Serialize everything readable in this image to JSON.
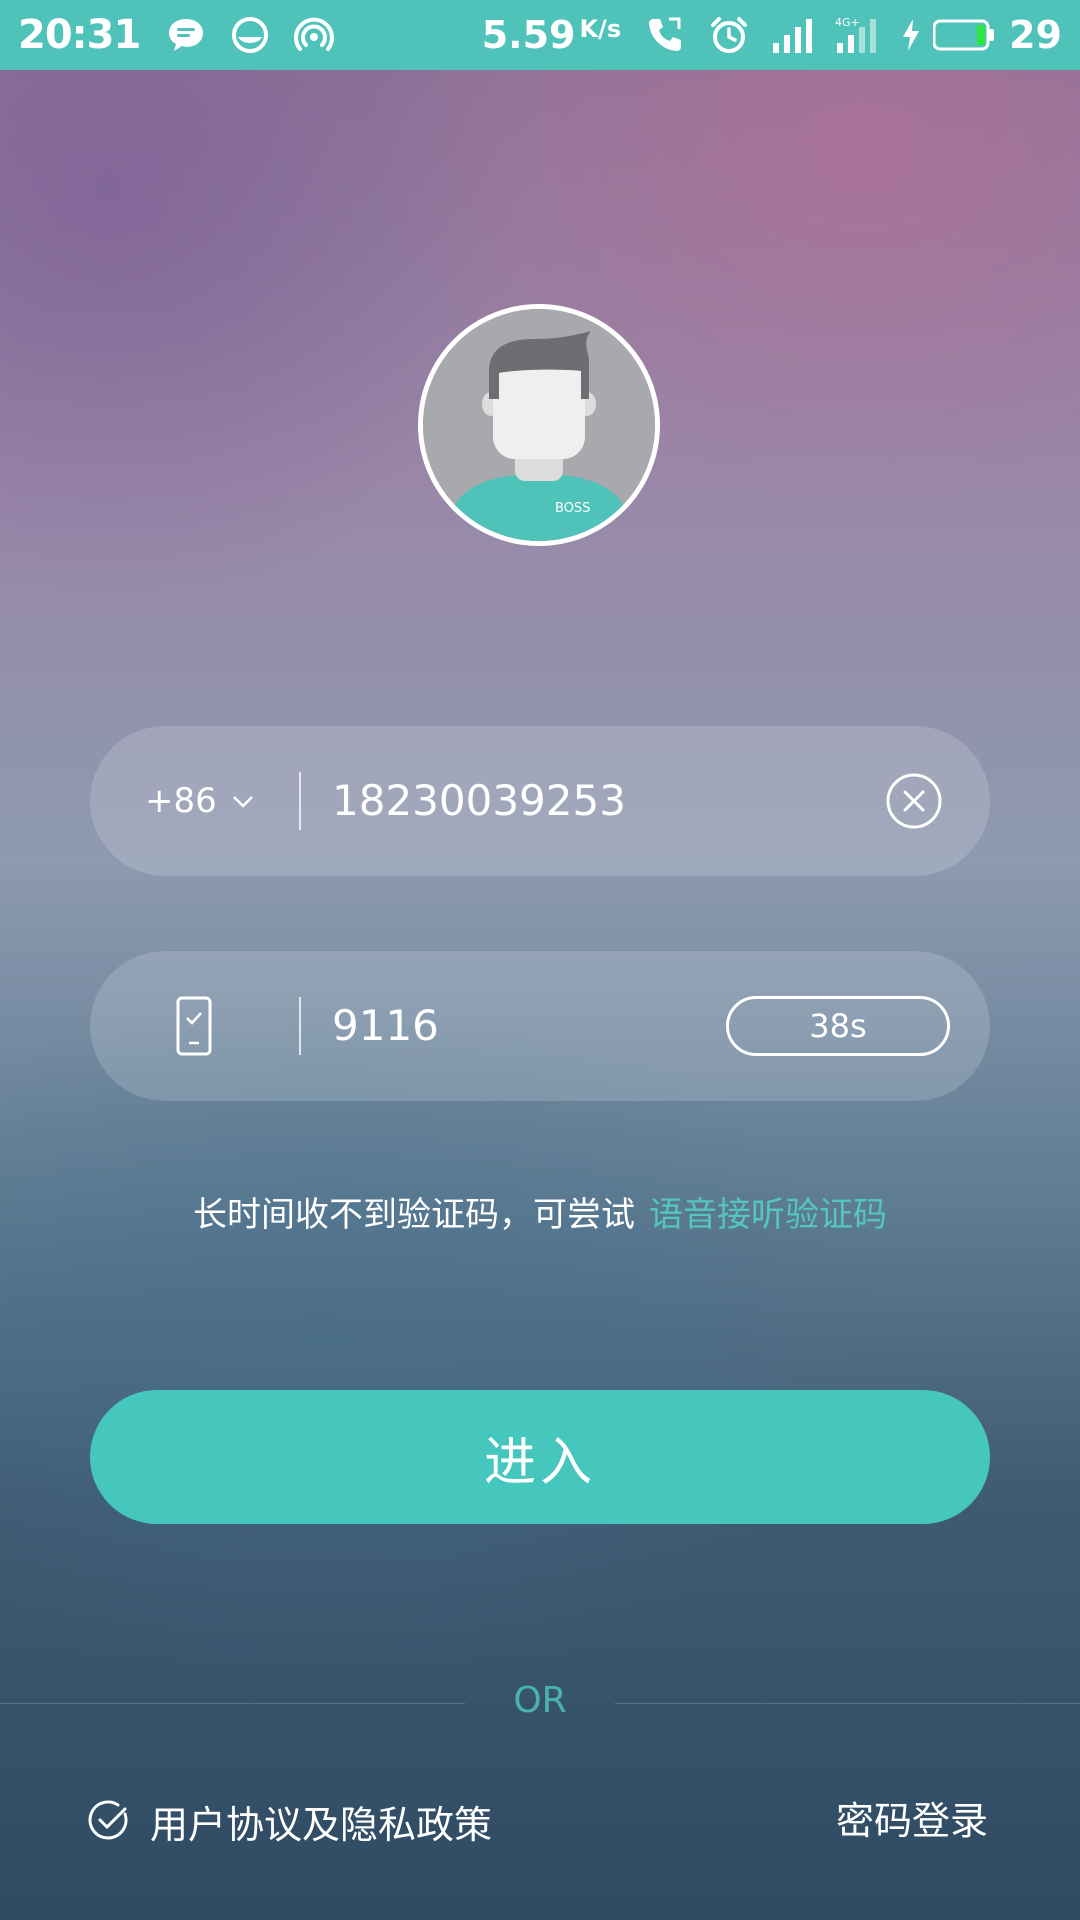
{
  "status_bar": {
    "time": "20:31",
    "speed": "5.59",
    "speed_unit": "K/s",
    "network_label": "4G+",
    "battery_level": "29",
    "icons": [
      "message-icon",
      "browser-icon",
      "hotspot-icon",
      "call-icon",
      "alarm-icon",
      "signal-icon",
      "signal-4g-icon",
      "charging-icon",
      "battery-icon"
    ],
    "background_color": "#4fc3b9"
  },
  "avatar": {
    "badge_text": "BOSS",
    "shirt_color": "#4fc3b9"
  },
  "phone_field": {
    "country_code": "+86",
    "value": "18230039253"
  },
  "code_field": {
    "value": "9116",
    "countdown": "38s"
  },
  "hint": {
    "text": "长时间收不到验证码，可尝试",
    "link": "语音接听验证码",
    "link_color": "#54c6bb"
  },
  "enter_button": {
    "label": "进入",
    "color": "#45c7bd"
  },
  "separator": {
    "label": "OR"
  },
  "footer": {
    "agreement": "用户协议及隐私政策",
    "password_login": "密码登录"
  }
}
